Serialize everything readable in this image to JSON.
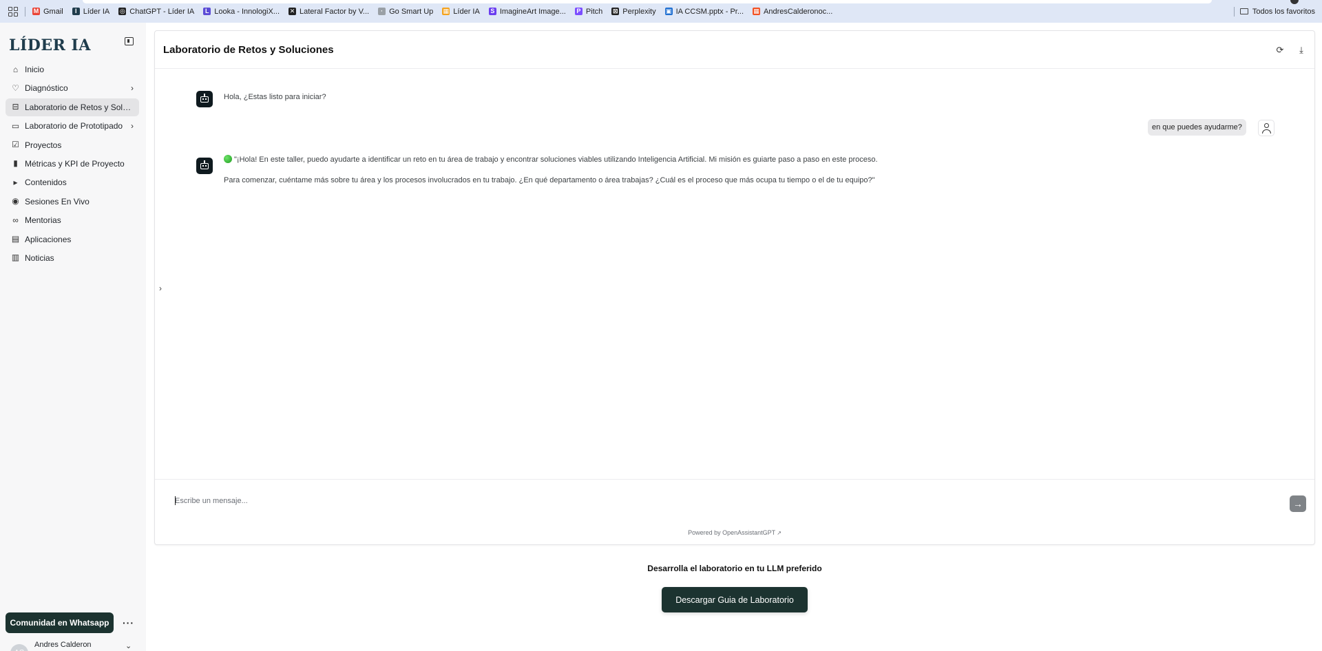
{
  "bookmarks": {
    "items": [
      {
        "label": "Gmail",
        "color": "#ea4335",
        "glyph": "M"
      },
      {
        "label": "Líder IA",
        "color": "#1f3c4c",
        "glyph": "I"
      },
      {
        "label": "ChatGPT - Líder IA",
        "color": "#222222",
        "glyph": "◎"
      },
      {
        "label": "Looka - InnologiX...",
        "color": "#5b4bd6",
        "glyph": "L"
      },
      {
        "label": "Lateral Factor by V...",
        "color": "#222222",
        "glyph": "✕"
      },
      {
        "label": "Go Smart Up",
        "color": "#9aa0a6",
        "glyph": "·"
      },
      {
        "label": "Líder IA",
        "color": "#f4a21d",
        "glyph": "▦"
      },
      {
        "label": "ImagineArt Image...",
        "color": "#6a3df0",
        "glyph": "S"
      },
      {
        "label": "Pitch",
        "color": "#7b4dff",
        "glyph": "P"
      },
      {
        "label": "Perplexity",
        "color": "#222222",
        "glyph": "⊠"
      },
      {
        "label": "IA CCSM.pptx - Pr...",
        "color": "#1f6fd1",
        "glyph": "▣"
      },
      {
        "label": "AndresCalderonoc...",
        "color": "#f25022",
        "glyph": "▦"
      }
    ],
    "all_bookmarks": "Todos los favoritos"
  },
  "sidebar": {
    "logo": "LÍDER IA",
    "items": [
      {
        "label": "Inicio",
        "icon": "home-icon",
        "glyph": "⌂",
        "chevron": false,
        "active": false
      },
      {
        "label": "Diagnóstico",
        "icon": "heart-icon",
        "glyph": "♡",
        "chevron": true,
        "active": false
      },
      {
        "label": "Laboratorio de Retos y Soluciones",
        "icon": "inbox-icon",
        "glyph": "⊟",
        "chevron": false,
        "active": true
      },
      {
        "label": "Laboratorio de Prototipado",
        "icon": "folder-icon",
        "glyph": "▭",
        "chevron": true,
        "active": false
      },
      {
        "label": "Proyectos",
        "icon": "clipboard-check-icon",
        "glyph": "☑",
        "chevron": false,
        "active": false
      },
      {
        "label": "Métricas y KPI de Proyecto",
        "icon": "bar-chart-icon",
        "glyph": "▮",
        "chevron": false,
        "active": false
      },
      {
        "label": "Contenidos",
        "icon": "video-icon",
        "glyph": "▸",
        "chevron": false,
        "active": false
      },
      {
        "label": "Sesiones En Vivo",
        "icon": "camera-icon",
        "glyph": "◉",
        "chevron": false,
        "active": false
      },
      {
        "label": "Mentorias",
        "icon": "link-icon",
        "glyph": "∞",
        "chevron": false,
        "active": false
      },
      {
        "label": "Aplicaciones",
        "icon": "calendar-icon",
        "glyph": "▤",
        "chevron": false,
        "active": false
      },
      {
        "label": "Noticias",
        "icon": "newspaper-icon",
        "glyph": "▥",
        "chevron": false,
        "active": false
      }
    ],
    "whatsapp_button": "Comunidad en Whatsapp",
    "more": "···",
    "user": {
      "initials": "AC",
      "name": "Andres Calderon"
    }
  },
  "chat": {
    "title": "Laboratorio de Retos y Soluciones",
    "messages": {
      "bot_1": "Hola, ¿Estas listo para iniciar?",
      "user_1": "en que puedes ayudarme?",
      "bot_2_line_1": "\"¡Hola! En este taller, puedo ayudarte a identificar un reto en tu área de trabajo y encontrar soluciones viables utilizando Inteligencia Artificial. Mi misión es guiarte paso a paso en este proceso.",
      "bot_2_line_2": "Para comenzar, cuéntame más sobre tu área y los procesos involucrados en tu trabajo. ¿En qué departamento o área trabajas? ¿Cuál es el proceso que más ocupa tu tiempo o el de tu equipo?\""
    },
    "input_placeholder": "Escribe un mensaje...",
    "powered_by_prefix": "Powered by ",
    "powered_by_link": "OpenAssistantGPT"
  },
  "footer": {
    "title": "Desarrolla el laboratorio en tu LLM preferido",
    "button": "Descargar Guia de Laboratorio"
  }
}
